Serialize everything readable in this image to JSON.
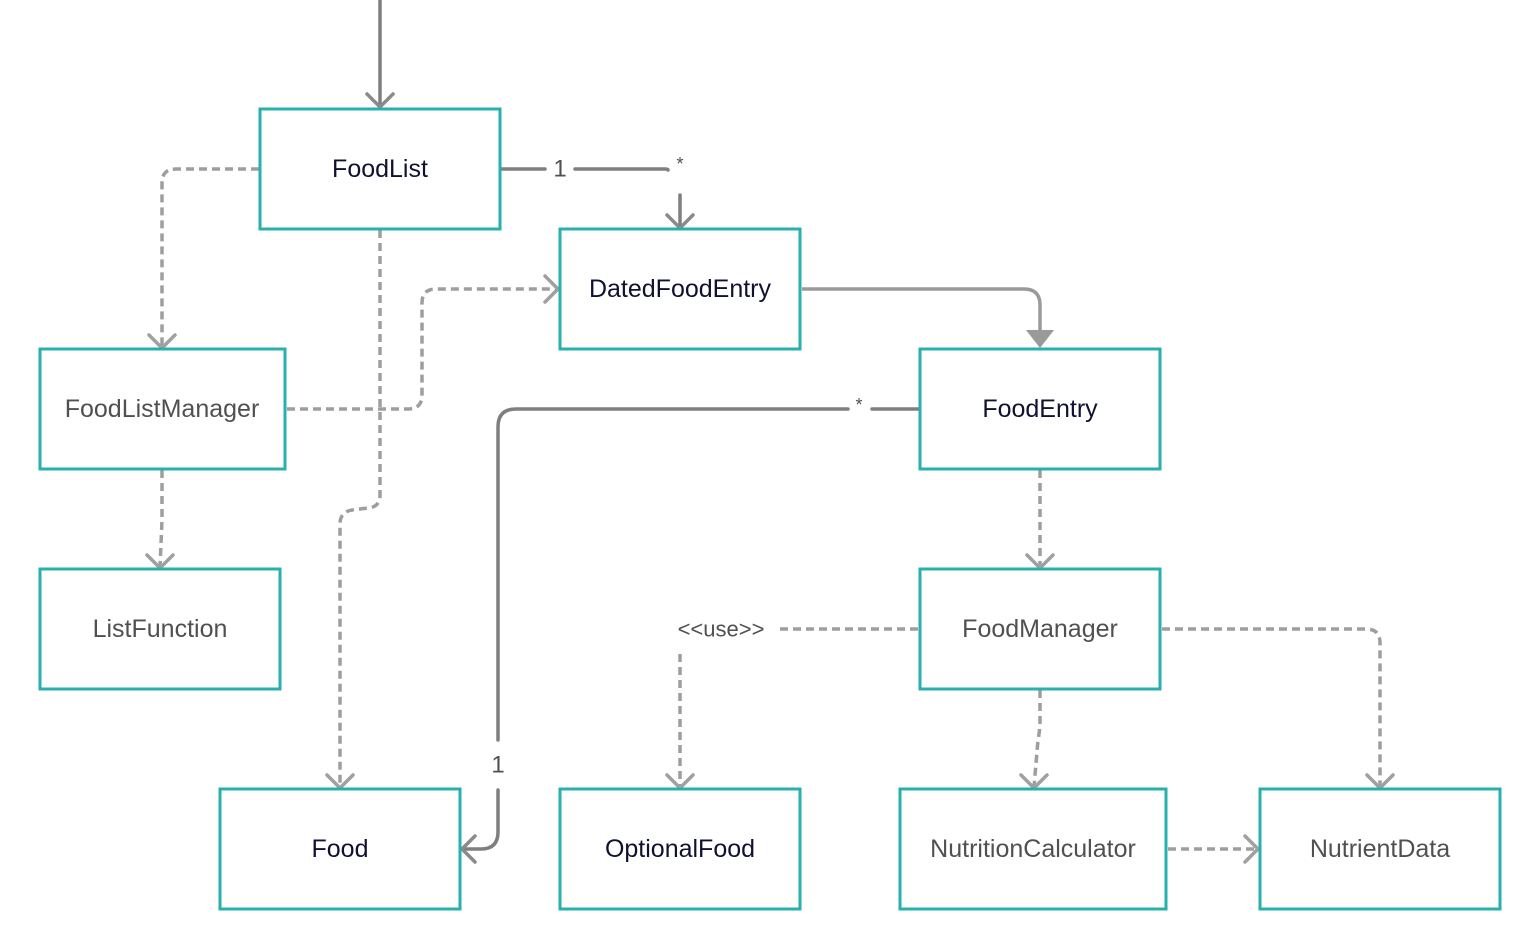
{
  "diagram": {
    "type": "UML class diagram",
    "colors": {
      "node_border": "#27b0ac",
      "connector": "#7f7f7f",
      "dependency": "#9e9e9e",
      "label_primary": "#101030",
      "label_secondary": "#505050"
    },
    "nodes": {
      "foodlist": {
        "label": "FoodList"
      },
      "datedfoodentry": {
        "label": "DatedFoodEntry"
      },
      "foodlistmanager": {
        "label": "FoodListManager"
      },
      "foodentry": {
        "label": "FoodEntry"
      },
      "listfunction": {
        "label": "ListFunction"
      },
      "foodmanager": {
        "label": "FoodManager"
      },
      "food": {
        "label": "Food"
      },
      "optionalfood": {
        "label": "OptionalFood"
      },
      "nutritioncalculator": {
        "label": "NutritionCalculator"
      },
      "nutrientdata": {
        "label": "NutrientData"
      }
    },
    "edges": [
      {
        "from": "(external)",
        "to": "FoodList",
        "kind": "association"
      },
      {
        "from": "FoodList",
        "to": "DatedFoodEntry",
        "kind": "association",
        "source_multiplicity": "1",
        "target_multiplicity": "*"
      },
      {
        "from": "FoodList",
        "to": "FoodListManager",
        "kind": "dependency"
      },
      {
        "from": "FoodList",
        "to": "Food",
        "kind": "dependency"
      },
      {
        "from": "FoodListManager",
        "to": "DatedFoodEntry",
        "kind": "dependency"
      },
      {
        "from": "FoodListManager",
        "to": "ListFunction",
        "kind": "dependency"
      },
      {
        "from": "DatedFoodEntry",
        "to": "FoodEntry",
        "kind": "generalization"
      },
      {
        "from": "FoodEntry",
        "to": "Food",
        "kind": "association",
        "source_multiplicity": "*",
        "target_multiplicity": "1"
      },
      {
        "from": "FoodEntry",
        "to": "FoodManager",
        "kind": "dependency"
      },
      {
        "from": "FoodManager",
        "to": "OptionalFood",
        "kind": "dependency",
        "stereotype": "<<use>>"
      },
      {
        "from": "FoodManager",
        "to": "NutritionCalculator",
        "kind": "dependency"
      },
      {
        "from": "FoodManager",
        "to": "NutrientData",
        "kind": "dependency"
      },
      {
        "from": "NutritionCalculator",
        "to": "NutrientData",
        "kind": "dependency"
      }
    ],
    "labels": {
      "foodlist_dated_source": "1",
      "foodlist_dated_target": "*",
      "foodentry_food_source": "*",
      "foodentry_food_target": "1",
      "use_stereotype": "<<use>>"
    }
  }
}
